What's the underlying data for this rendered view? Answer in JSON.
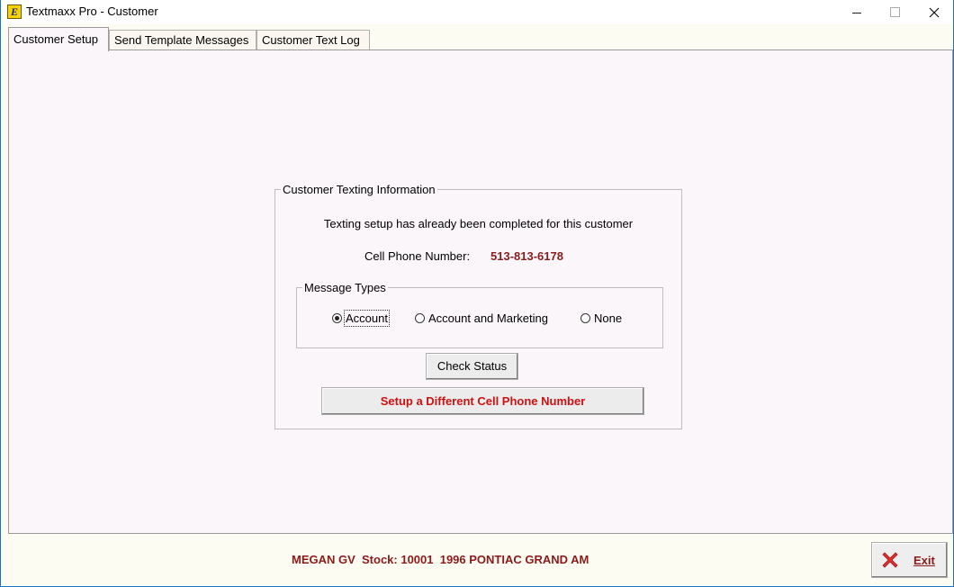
{
  "window": {
    "title": "Textmaxx Pro - Customer",
    "icon_glyph": "E"
  },
  "tabs": [
    {
      "label": "Customer Setup",
      "active": true
    },
    {
      "label": "Send Template Messages",
      "active": false
    },
    {
      "label": "Customer Text Log",
      "active": false
    }
  ],
  "group": {
    "legend": "Customer Texting Information",
    "info_text": "Texting setup has already been completed for this customer",
    "phone_label": "Cell Phone Number:",
    "phone_value": "513-813-6178",
    "message_types": {
      "legend": "Message Types",
      "options": [
        {
          "label": "Account",
          "checked": true
        },
        {
          "label": "Account and Marketing",
          "checked": false
        },
        {
          "label": "None",
          "checked": false
        }
      ]
    },
    "check_status_label": "Check Status",
    "setup_label": "Setup a Different Cell Phone Number"
  },
  "footer": {
    "status": "MEGAN GV  Stock: 10001  1996 PONTIAC GRAND AM",
    "exit_label": "Exit"
  },
  "colors": {
    "accent_red": "#8b1a1a",
    "setup_red": "#d01010",
    "panel_bg": "#fbf6fa",
    "window_bg": "#fdfcf2"
  }
}
